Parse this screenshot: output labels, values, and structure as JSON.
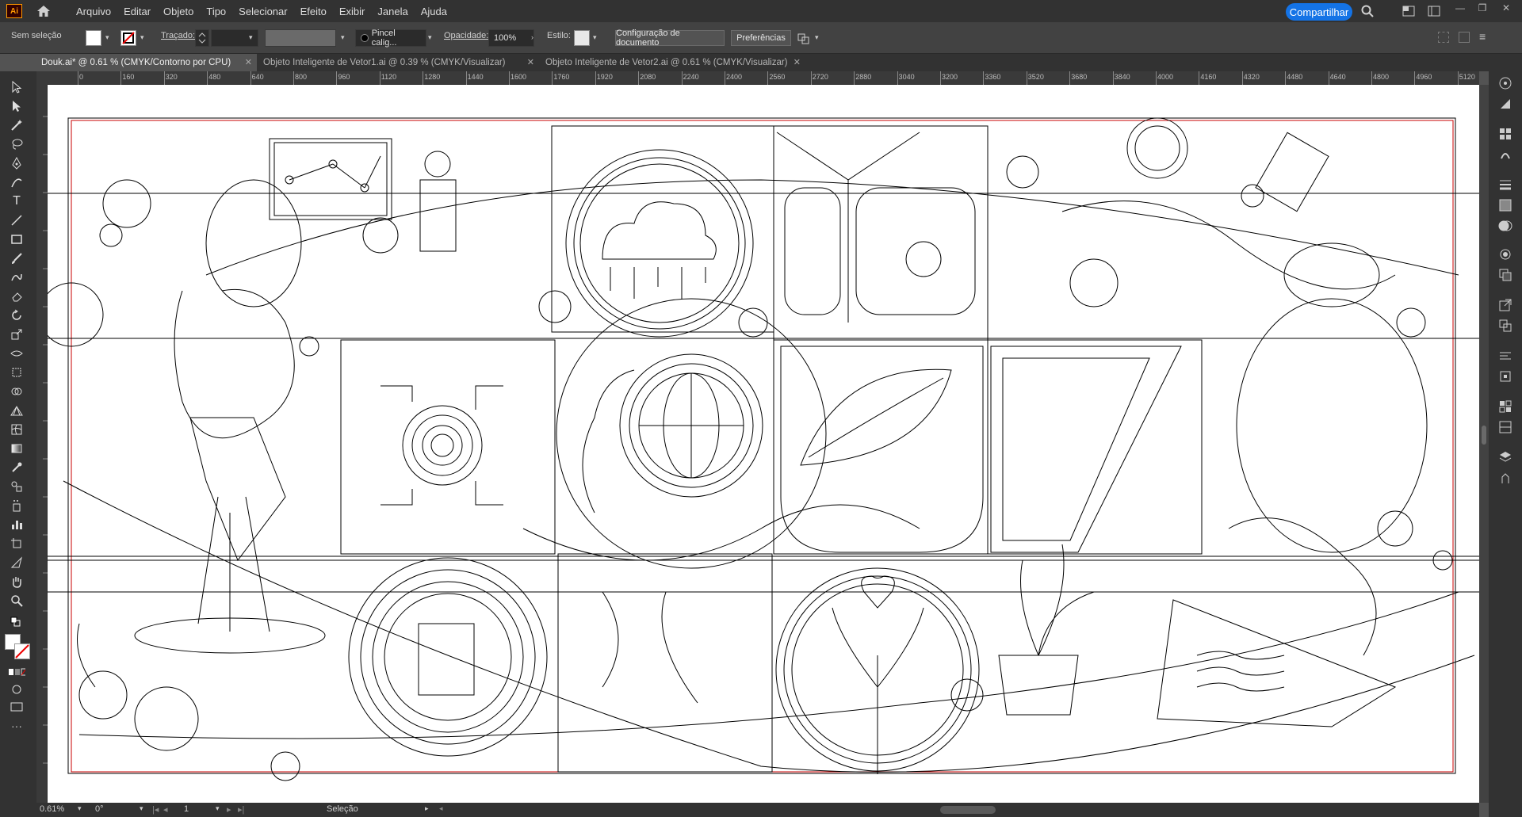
{
  "app": {
    "logo_text": "Ai"
  },
  "menu": [
    "Arquivo",
    "Editar",
    "Objeto",
    "Tipo",
    "Selecionar",
    "Efeito",
    "Exibir",
    "Janela",
    "Ajuda"
  ],
  "share_label": "Compartilhar",
  "control": {
    "selection": "Sem seleção",
    "stroke_label": "Traçado:",
    "brush": "Pincel calig...",
    "opacity_label": "Opacidade:",
    "opacity_value": "100%",
    "style_label": "Estilo:",
    "doc_setup": "Configuração de documento",
    "preferences": "Preferências"
  },
  "tabs": [
    {
      "label": "Douk.ai* @ 0.61 % (CMYK/Contorno por CPU)",
      "active": true
    },
    {
      "label": "Objeto Inteligente de Vetor1.ai @ 0.39 % (CMYK/Visualizar)",
      "active": false
    },
    {
      "label": "Objeto Inteligente de Vetor2.ai @ 0.61 % (CMYK/Visualizar)",
      "active": false
    }
  ],
  "ruler_labels": [
    "0",
    "160",
    "320",
    "480",
    "640",
    "800",
    "960",
    "1120",
    "1280",
    "1440",
    "1600",
    "1760",
    "1920",
    "2080",
    "2240",
    "2400",
    "2560",
    "2720",
    "2880",
    "3040",
    "3200",
    "3360",
    "3520",
    "3680",
    "3840",
    "4000",
    "4160",
    "4320",
    "4480",
    "4640",
    "4800",
    "4960",
    "5120"
  ],
  "status": {
    "zoom": "0.61%",
    "rotation": "0°",
    "artboard": "1",
    "mode": "Seleção"
  },
  "colors": {
    "share": "#1473e6",
    "artboard_border": "#c80000",
    "accent": "#ff9a00"
  }
}
